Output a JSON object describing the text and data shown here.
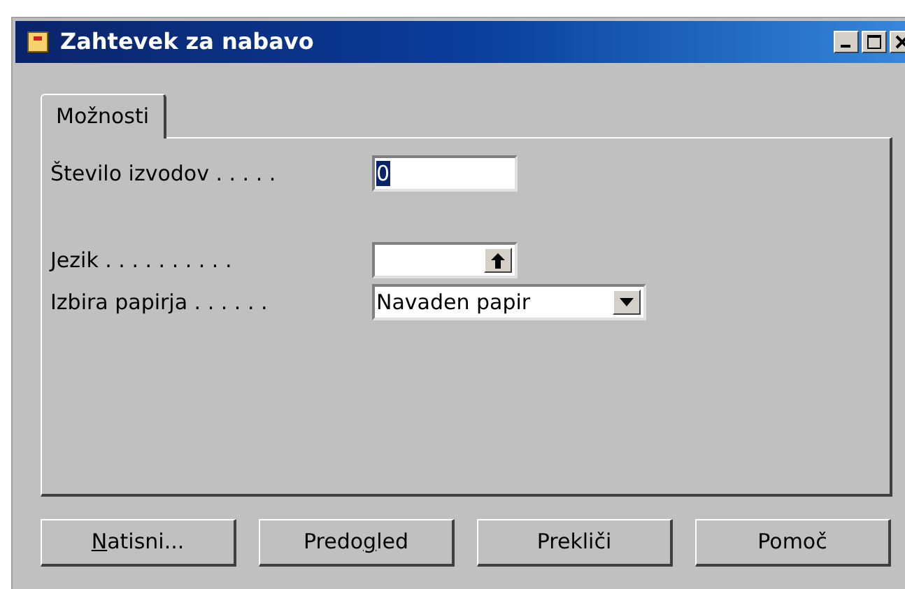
{
  "window": {
    "title": "Zahtevek za nabavo"
  },
  "tabs": [
    {
      "label": "Možnosti",
      "selected": true
    }
  ],
  "fields": [
    {
      "kind": "text",
      "label": "Število izvodov . . . . .",
      "value": "0",
      "value_selected": true
    },
    {
      "kind": "lookup",
      "label": "Jezik . . . . . . . . . ."
    },
    {
      "kind": "dropdown",
      "label": "Izbira papirja . . . . . .",
      "value": "Navaden papir"
    }
  ],
  "buttons": [
    {
      "key": "N",
      "rest": "atisni..."
    },
    {
      "prefix": "Predo",
      "key": "g",
      "rest": "led"
    },
    {
      "rest": "Prekliči"
    },
    {
      "rest": "Pomoč"
    }
  ]
}
